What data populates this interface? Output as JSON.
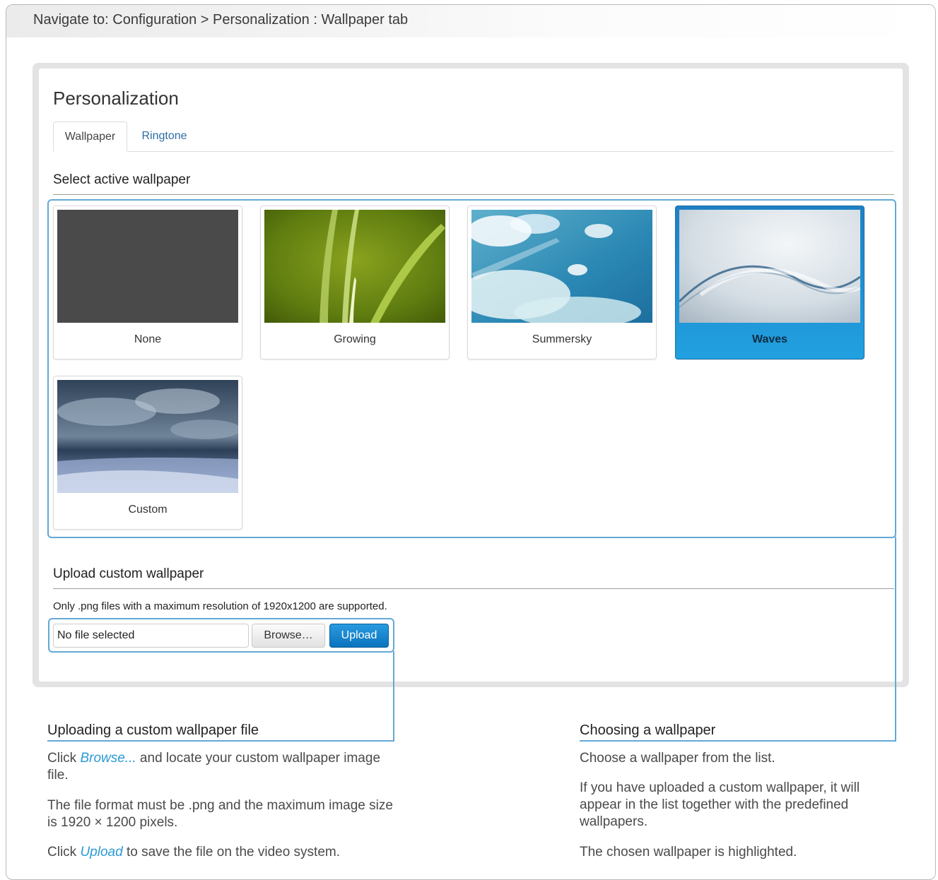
{
  "breadcrumb": "Navigate to: Configuration > Personalization : Wallpaper tab",
  "page_title": "Personalization",
  "tabs": [
    {
      "label": "Wallpaper",
      "active": true
    },
    {
      "label": "Ringtone",
      "active": false
    }
  ],
  "select_section": {
    "title": "Select active wallpaper",
    "wallpapers": [
      {
        "label": "None",
        "selected": false
      },
      {
        "label": "Growing",
        "selected": false
      },
      {
        "label": "Summersky",
        "selected": false
      },
      {
        "label": "Waves",
        "selected": true
      },
      {
        "label": "Custom",
        "selected": false
      }
    ]
  },
  "upload_section": {
    "title": "Upload custom wallpaper",
    "note": "Only .png files with a maximum resolution of 1920x1200 are supported.",
    "file_value": "No file selected",
    "browse_label": "Browse…",
    "upload_label": "Upload"
  },
  "annotations": {
    "upload": {
      "title": "Uploading a custom wallpaper file",
      "p1_pre": "Click ",
      "p1_em": "Browse...",
      "p1_post": " and locate your custom wallpaper image file.",
      "p2": "The file format must be .png and the maximum image size is 1920 × 1200 pixels.",
      "p3_pre": "Click ",
      "p3_em": "Upload",
      "p3_post": " to save the file on the video system."
    },
    "choose": {
      "title": "Choosing a wallpaper",
      "p1": "Choose a wallpaper from the list.",
      "p2": "If you have uploaded a custom wallpaper, it will appear in the list together with the predefined wallpapers.",
      "p3": "The chosen wallpaper is highlighted."
    }
  },
  "colors": {
    "accent": "#64a8d6",
    "selected_card": "#21a0e0",
    "link": "#2d6ca2",
    "emphasis": "#2a9ad5"
  }
}
